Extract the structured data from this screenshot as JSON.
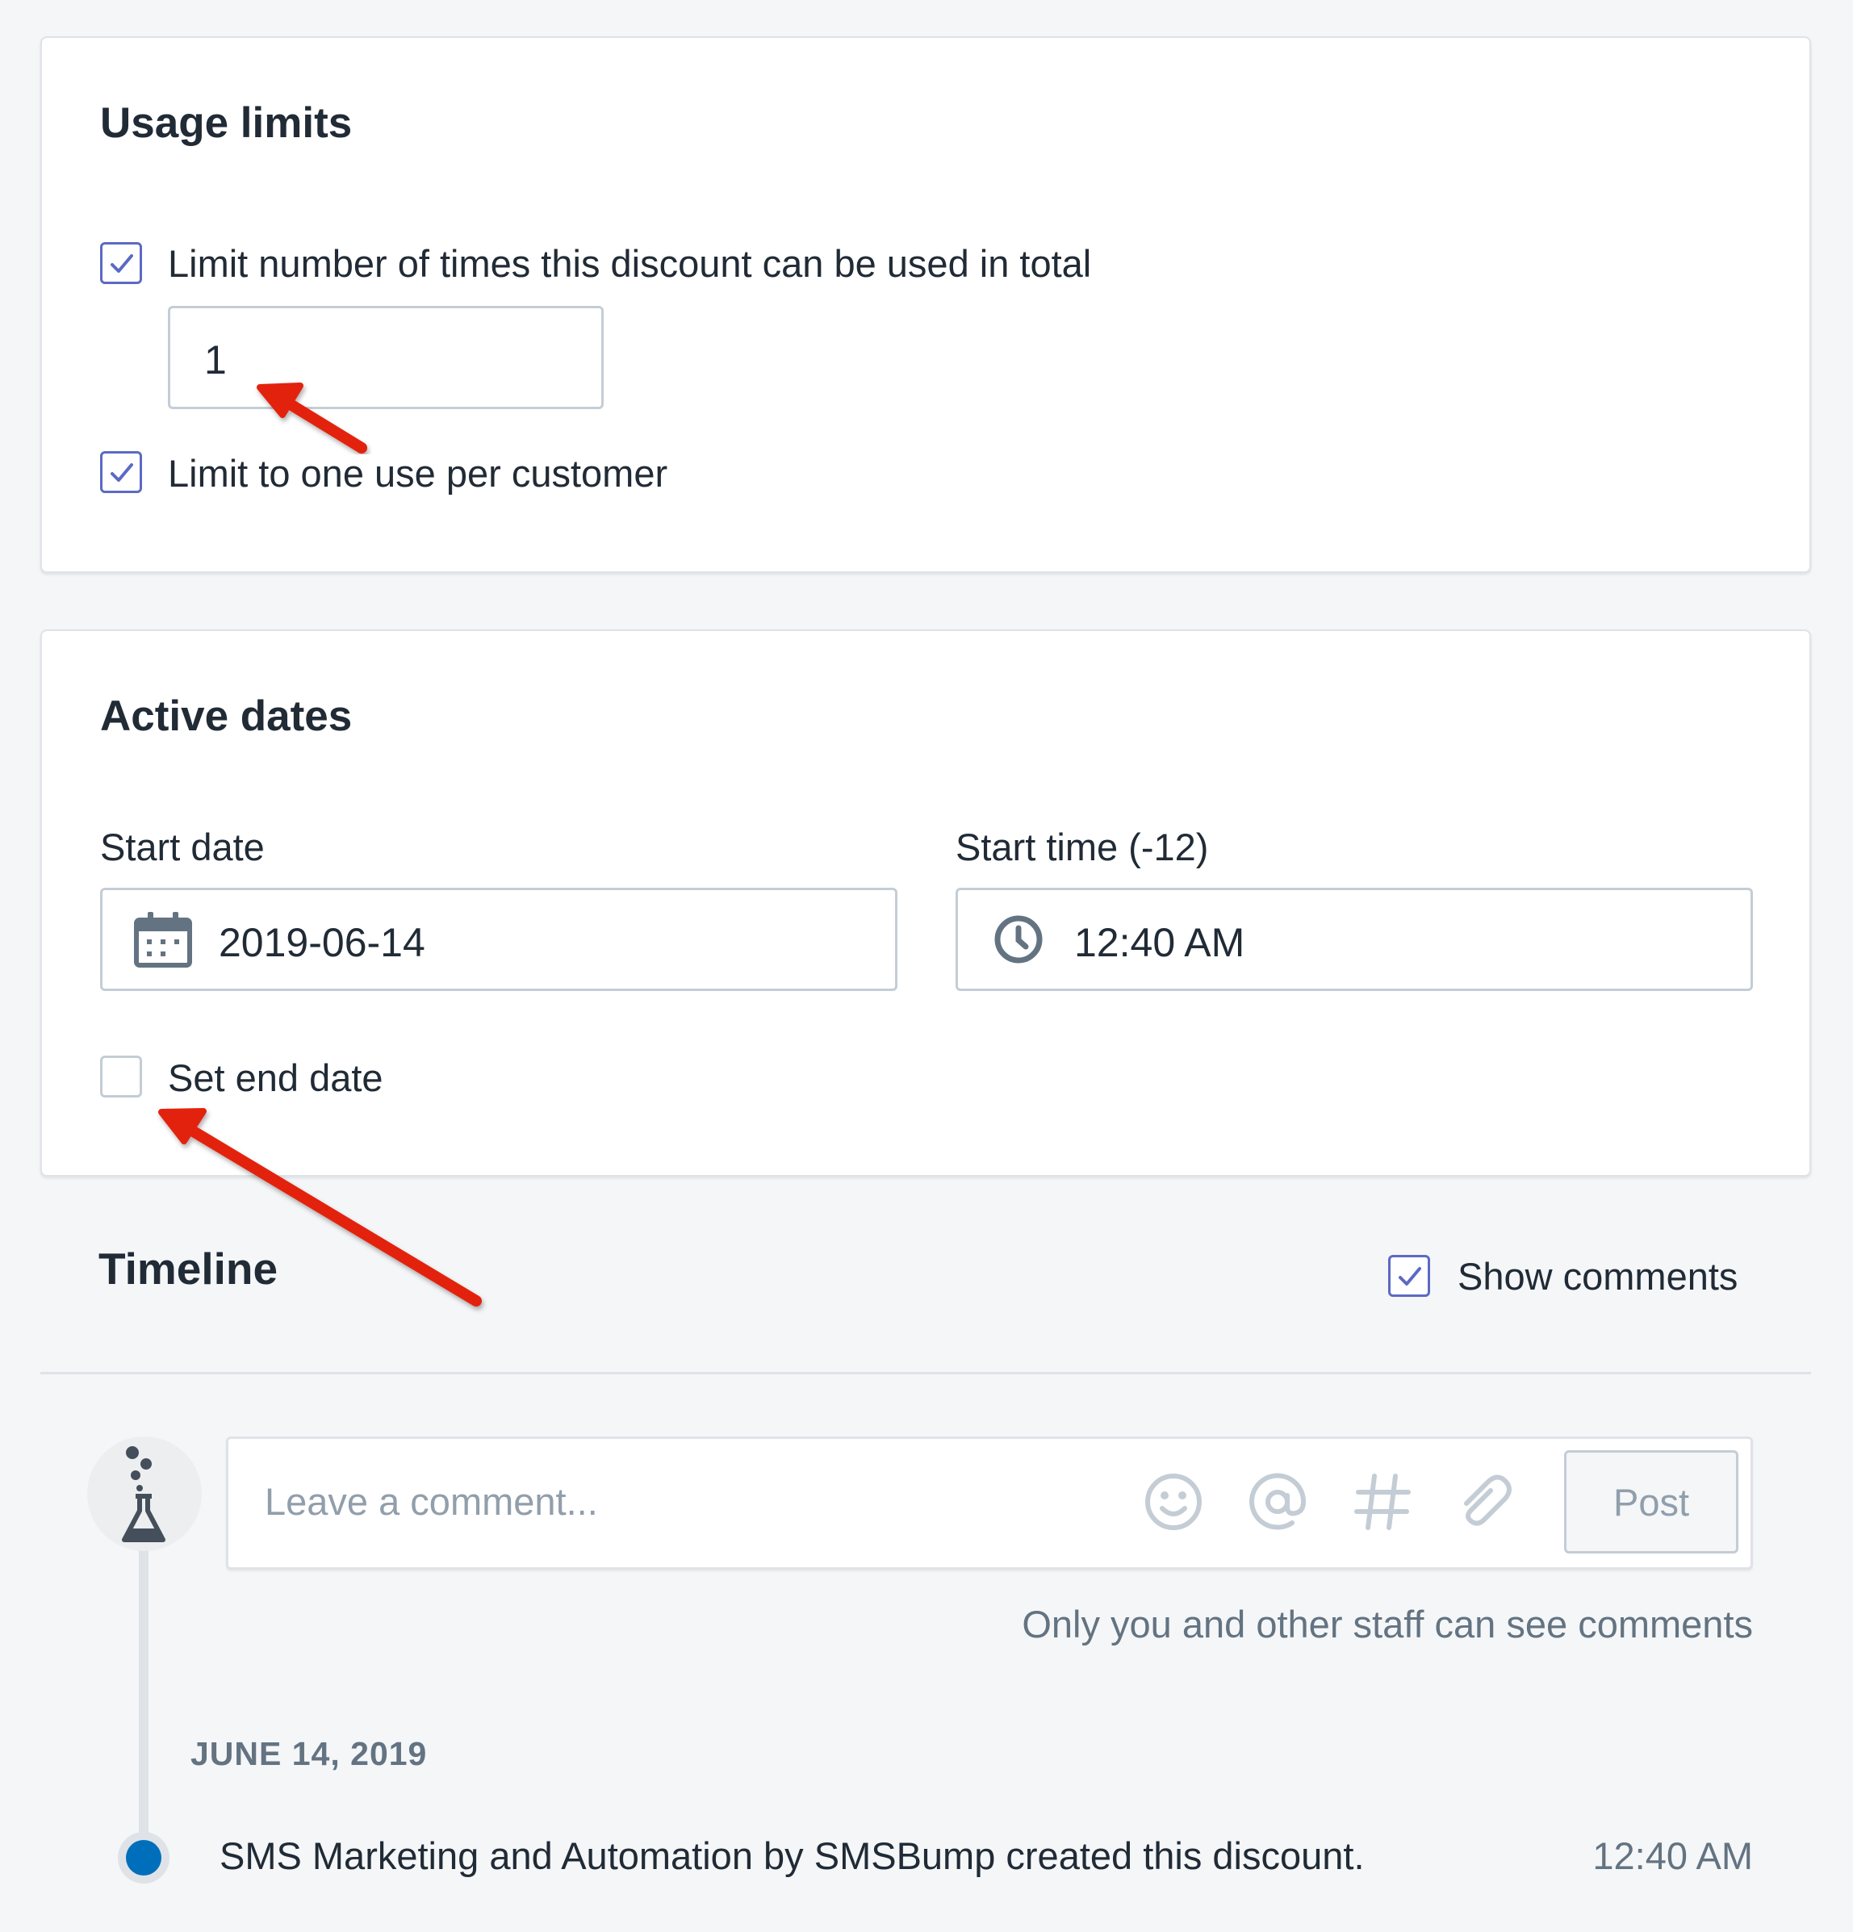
{
  "usage_limits": {
    "title": "Usage limits",
    "limit_total": {
      "label": "Limit number of times this discount can be used in total",
      "checked": true,
      "value": "1"
    },
    "limit_per_customer": {
      "label": "Limit to one use per customer",
      "checked": true
    }
  },
  "active_dates": {
    "title": "Active dates",
    "start_date": {
      "label": "Start date",
      "value": "2019-06-14",
      "icon": "calendar-icon"
    },
    "start_time": {
      "label": "Start time (-12)",
      "value": "12:40 AM",
      "icon": "clock-icon"
    },
    "set_end_date": {
      "label": "Set end date",
      "checked": false
    }
  },
  "timeline": {
    "title": "Timeline",
    "show_comments": {
      "label": "Show comments",
      "checked": true
    },
    "comment": {
      "placeholder": "Leave a comment...",
      "post_label": "Post",
      "icons": [
        "emoji-icon",
        "mention-icon",
        "hashtag-icon",
        "attachment-icon"
      ]
    },
    "staff_note": "Only you and other staff can see comments",
    "date_heading": "JUNE 14, 2019",
    "events": [
      {
        "text": "SMS Marketing and Automation by SMSBump created this discount.",
        "time": "12:40 AM"
      }
    ]
  },
  "colors": {
    "accent": "#5c6ac4",
    "event_dot": "#006fbb",
    "annotation_arrow": "#e3220f"
  }
}
